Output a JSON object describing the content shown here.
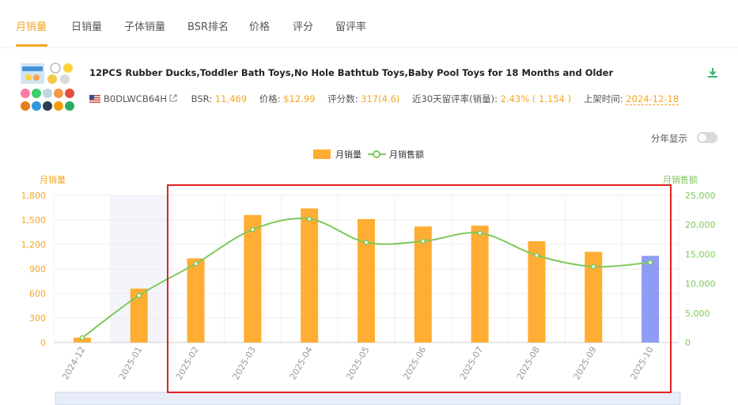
{
  "tabs": [
    {
      "label": "月销量",
      "active": true
    },
    {
      "label": "日销量",
      "active": false
    },
    {
      "label": "子体销量",
      "active": false
    },
    {
      "label": "BSR排名",
      "active": false
    },
    {
      "label": "价格",
      "active": false
    },
    {
      "label": "评分",
      "active": false
    },
    {
      "label": "留评率",
      "active": false
    }
  ],
  "product": {
    "title": "12PCS Rubber Ducks,Toddler Bath Toys,No Hole Bathtub Toys,Baby Pool Toys for 18 Months and Older",
    "asin": "B0DLWCB64H",
    "bsr_label": "BSR:",
    "bsr_value": "11,469",
    "price_label": "价格:",
    "price_value": "$12.99",
    "reviews_label": "评分数:",
    "reviews_value": "317(4.6)",
    "review_rate_label": "近30天留评率(销量):",
    "review_rate_value": "2.43% ( 1,154 )",
    "listed_label": "上架时间:",
    "listed_value": "2024-12-18",
    "flag_icon": "us-flag-icon",
    "ext_icon": "external-link-icon",
    "download_icon": "download-icon"
  },
  "toggle": {
    "label": "分年显示",
    "on": false
  },
  "chart_data": {
    "type": "bar",
    "categories": [
      "2024-12",
      "2025-01",
      "2025-02",
      "2025-03",
      "2025-04",
      "2025-05",
      "2025-06",
      "2025-07",
      "2025-08",
      "2025-09",
      "2025-10"
    ],
    "series": [
      {
        "name": "月销量",
        "type": "bar",
        "axis": "left",
        "color": "#ffad33",
        "highlight_last_color": "#8f9cf5",
        "values": [
          60,
          660,
          1030,
          1560,
          1640,
          1510,
          1420,
          1430,
          1240,
          1110,
          1060
        ]
      },
      {
        "name": "月销售额",
        "type": "line",
        "axis": "right",
        "color": "#7ec95b",
        "values": [
          800,
          8000,
          13400,
          19200,
          21000,
          17000,
          17200,
          18600,
          14800,
          12900,
          13600
        ]
      }
    ],
    "y_left": {
      "label": "月销量",
      "ticks": [
        "1,800",
        "1,500",
        "1,200",
        "900",
        "600",
        "300",
        "0"
      ],
      "range": [
        0,
        1800
      ]
    },
    "y_right": {
      "label": "月销售额",
      "ticks": [
        "25,000",
        "20,000",
        "15,000",
        "10,000",
        "5,000",
        "0"
      ],
      "range": [
        0,
        25000
      ]
    },
    "highlighted_category": "2025-01",
    "grid": true,
    "legend_position": "top"
  }
}
